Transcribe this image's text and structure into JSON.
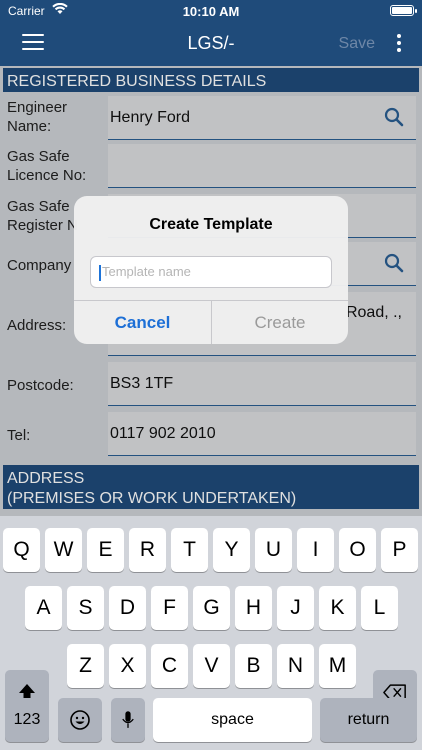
{
  "status": {
    "carrier": "Carrier",
    "time": "10:10 AM"
  },
  "nav": {
    "title": "LGS/-",
    "save_label": "Save"
  },
  "sections": {
    "registered": "REGISTERED BUSINESS DETAILS",
    "address_line1": "ADDRESS",
    "address_line2": "(PREMISES OR WORK UNDERTAKEN)"
  },
  "form": {
    "engineer_label_1": "Engineer",
    "engineer_label_2": "Name:",
    "engineer_value": "Henry Ford",
    "licence_label_1": "Gas Safe",
    "licence_label_2": "Licence No:",
    "licence_value": "",
    "register_label_1": "Gas Safe",
    "register_label_2": "Register N",
    "company_label": "Company",
    "address_label": "Address:",
    "address_value": "Road, .,",
    "postcode_label": "Postcode:",
    "postcode_value": "BS3 1TF",
    "tel_label": "Tel:",
    "tel_value": "0117 902 2010"
  },
  "dialog": {
    "title": "Create Template",
    "placeholder": "Template name",
    "cancel": "Cancel",
    "create": "Create"
  },
  "keyboard": {
    "row1": [
      "Q",
      "W",
      "E",
      "R",
      "T",
      "Y",
      "U",
      "I",
      "O",
      "P"
    ],
    "row2": [
      "A",
      "S",
      "D",
      "F",
      "G",
      "H",
      "J",
      "K",
      "L"
    ],
    "row3": [
      "Z",
      "X",
      "C",
      "V",
      "B",
      "N",
      "M"
    ],
    "numbers": "123",
    "space": "space",
    "return": "return"
  }
}
